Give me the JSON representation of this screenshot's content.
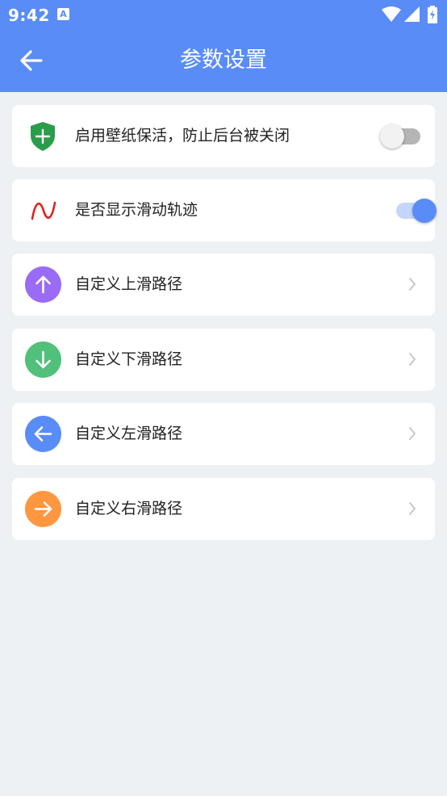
{
  "status_bar": {
    "time": "9:42",
    "notification_icon": "A"
  },
  "header": {
    "title": "参数设置",
    "back_icon": "arrow-left-icon"
  },
  "colors": {
    "header": "#5a8cf7",
    "shield": "#2a9d4a",
    "trail": "#e02020",
    "up": "#9a6cf5",
    "down": "#50c07a",
    "left": "#5a8cf7",
    "right": "#ff9640",
    "toggle_on": "#5a8cf7"
  },
  "settings": [
    {
      "label": "启用壁纸保活，防止后台被关闭",
      "icon": "shield-plus-icon",
      "type": "toggle",
      "enabled": false
    },
    {
      "label": "是否显示滑动轨迹",
      "icon": "wave-trail-icon",
      "type": "toggle",
      "enabled": true
    },
    {
      "label": "自定义上滑路径",
      "icon": "arrow-up-icon",
      "type": "link"
    },
    {
      "label": "自定义下滑路径",
      "icon": "arrow-down-icon",
      "type": "link"
    },
    {
      "label": "自定义左滑路径",
      "icon": "arrow-left-icon",
      "type": "link"
    },
    {
      "label": "自定义右滑路径",
      "icon": "arrow-right-icon",
      "type": "link"
    }
  ]
}
